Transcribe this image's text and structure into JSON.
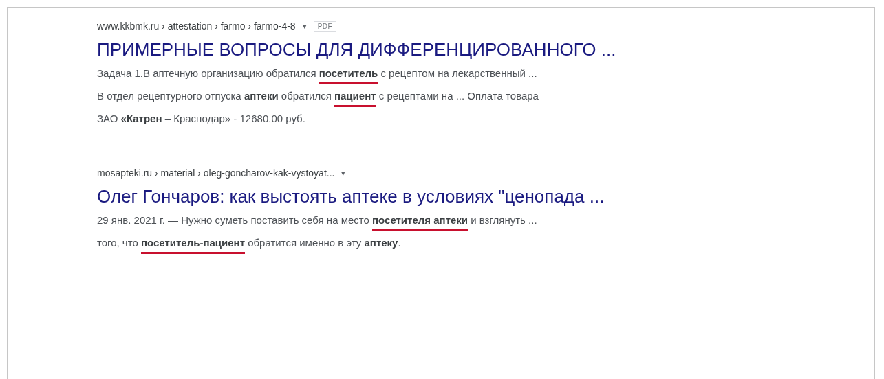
{
  "results": [
    {
      "breadcrumb": "www.kkbmk.ru › attestation › farmo › farmo-4-8",
      "menu_caret": "▾",
      "badge": "PDF",
      "title": "ПРИМЕРНЫЕ ВОПРОСЫ ДЛЯ ДИФФЕРЕНЦИРОВАННОГО ...",
      "snippet_lines": [
        [
          {
            "kind": "plain",
            "text": "Задача 1.В аптечную организацию обратился "
          },
          {
            "kind": "underlined",
            "text": "**посетитель**"
          },
          {
            "kind": "plain",
            "text": " с рецептом на лекарственный ..."
          }
        ],
        [
          {
            "kind": "plain",
            "text": "В отдел рецептурного отпуска **аптеки** обратился "
          },
          {
            "kind": "underlined",
            "text": "**пациент**"
          },
          {
            "kind": "plain",
            "text": " с рецептами на ... Оплата товара"
          }
        ],
        [
          {
            "kind": "plain",
            "text": "ЗАО **«Катрен** – Краснодар» - 12680.00 руб."
          }
        ]
      ]
    },
    {
      "breadcrumb": "mosapteki.ru › material › oleg-goncharov-kak-vystoyat...",
      "menu_caret": "▾",
      "title": "Олег Гончаров: как выстоять аптеке в условиях \"ценопада ...",
      "snippet_lines": [
        [
          {
            "kind": "plain",
            "text": "29 янв. 2021 г. — Нужно суметь поставить себя на место "
          },
          {
            "kind": "underlined",
            "text": "**посетителя аптеки**"
          },
          {
            "kind": "plain",
            "text": " и взглянуть ..."
          }
        ],
        [
          {
            "kind": "plain",
            "text": "того, что "
          },
          {
            "kind": "underlined",
            "text": "**посетитель-пациент**"
          },
          {
            "kind": "plain",
            "text": " обратится именно в эту **аптеку**."
          }
        ]
      ]
    }
  ]
}
